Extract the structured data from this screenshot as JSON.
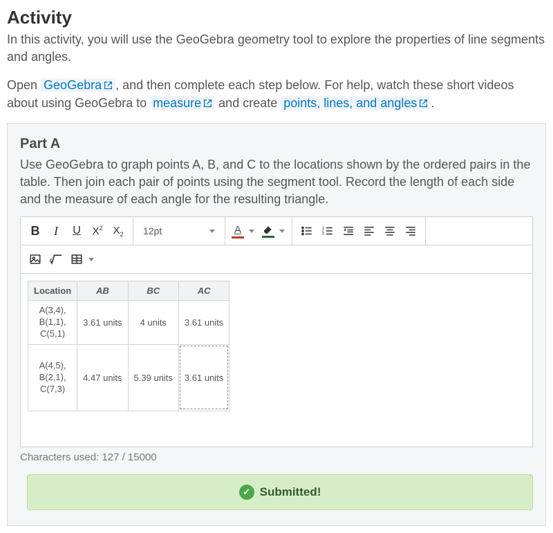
{
  "heading": "Activity",
  "intro": "In this activity, you will use the GeoGebra geometry tool to explore the properties of line segments and angles.",
  "p2_a": "Open ",
  "link1": "GeoGebra",
  "p2_b": ", and then complete each step below. For help, watch these short videos about using GeoGebra to ",
  "link2": "measure",
  "p2_c": " and create ",
  "link3": "points, lines, and angles",
  "p2_d": ".",
  "part": {
    "title": "Part A",
    "desc": "Use GeoGebra to graph points A, B, and C to the locations shown by the ordered pairs in the table. Then join each pair of points using the segment tool. Record the length of each side and the measure of each angle for the resulting triangle."
  },
  "toolbar": {
    "font_size": "12pt"
  },
  "table": {
    "headers": {
      "loc": "Location",
      "ab": "AB",
      "bc": "BC",
      "ac": "AC"
    },
    "rows": [
      {
        "loc_a": "A(3,4),",
        "loc_b": "B(1,1),",
        "loc_c": "C(5,1)",
        "ab": "3.61 units",
        "bc": "4 units",
        "ac": "3.61 units"
      },
      {
        "loc_a": "A(4,5),",
        "loc_b": "B(2,1),",
        "loc_c": "C(7,3)",
        "ab": "4.47 units",
        "bc": "5.39 units",
        "ac": "3.61 units"
      }
    ]
  },
  "char_count": "Characters used: 127 / 15000",
  "submitted": "Submitted!"
}
